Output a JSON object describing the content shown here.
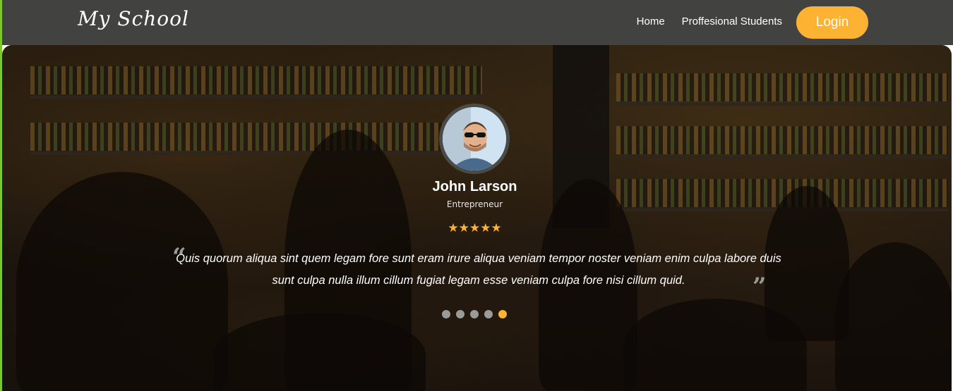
{
  "brand": {
    "name": "My School"
  },
  "nav": {
    "links": [
      {
        "label": "Home"
      },
      {
        "label": "Proffesional Students"
      }
    ],
    "login_label": "Login"
  },
  "testimonial": {
    "name": "John Larson",
    "role": "Entrepreneur",
    "rating": 5,
    "rating_display": "★★★★★",
    "quote_open": "“",
    "quote_close": "”",
    "quote": "Quis quorum aliqua sint quem legam fore sunt eram irure aliqua veniam tempor noster veniam enim culpa labore duis sunt culpa nulla illum cillum fugiat legam esse veniam culpa fore nisi cillum quid."
  },
  "carousel": {
    "slide_count": 5,
    "active_index": 4
  },
  "colors": {
    "navbar": "#424240",
    "accent": "#fdb232",
    "left_bar": "#7cc82a",
    "dot_inactive": "#9a9a98"
  }
}
